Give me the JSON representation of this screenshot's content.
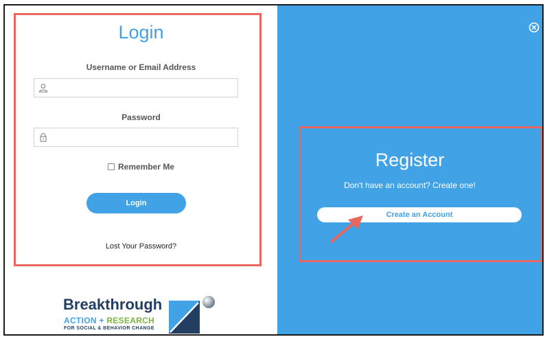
{
  "login": {
    "title": "Login",
    "username_label": "Username or Email Address",
    "username_value": "",
    "password_label": "Password",
    "password_value": "",
    "remember_label": "Remember Me",
    "remember_checked": false,
    "login_button": "Login",
    "lost_password_link": "Lost Your Password?"
  },
  "logo": {
    "line1": "Breakthrough",
    "line2_part1": "ACTION + ",
    "line2_part2": "RESEARCH",
    "line3": "FOR SOCIAL & BEHAVIOR CHANGE"
  },
  "register": {
    "title": "Register",
    "subtitle": "Don't have an account? Create one!",
    "create_button": "Create an Account"
  },
  "icons": {
    "user": "user-icon",
    "lock": "lock-icon",
    "close": "close-circle-icon",
    "arrow": "annotation-arrow-icon"
  },
  "colors": {
    "accent_blue": "#41a2e6",
    "highlight_red": "#e8685f",
    "logo_navy": "#243e61",
    "logo_green": "#7cb342"
  }
}
